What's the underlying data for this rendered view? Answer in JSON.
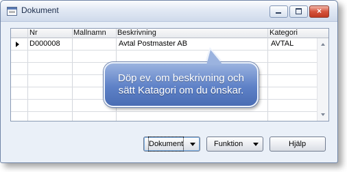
{
  "window": {
    "title": "Dokument"
  },
  "grid": {
    "columns": [
      "Nr",
      "Mallnamn",
      "Beskrivning",
      "Kategori"
    ],
    "rows": [
      {
        "nr": "D000008",
        "mallnamn": "",
        "beskrivning": "Avtal Postmaster AB",
        "kategori": "AVTAL"
      }
    ]
  },
  "balloon": {
    "line1": "Döp ev. om beskrivning och",
    "line2": "sätt Katagori om du önskar."
  },
  "buttons": {
    "dokument": "Dokument",
    "funktion": "Funktion",
    "hjalp": "Hjälp"
  },
  "close_glyph": "×"
}
